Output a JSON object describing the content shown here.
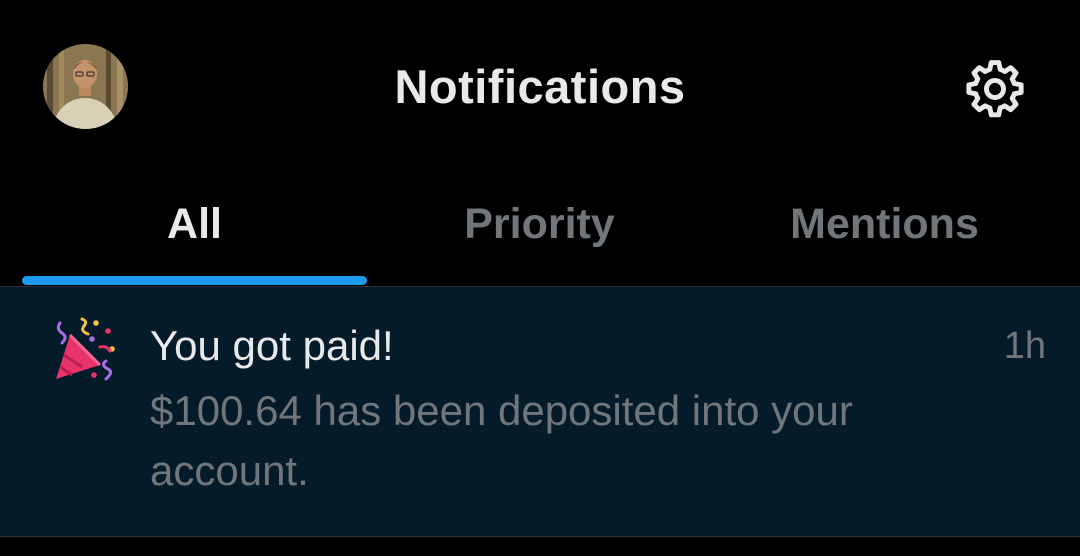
{
  "header": {
    "title": "Notifications",
    "avatar_icon": "user-avatar",
    "settings_icon": "gear-icon"
  },
  "tabs": [
    {
      "label": "All",
      "active": true
    },
    {
      "label": "Priority",
      "active": false
    },
    {
      "label": "Mentions",
      "active": false
    }
  ],
  "notifications": [
    {
      "icon": "party-popper-icon",
      "title": "You got paid!",
      "time": "1h",
      "body": "$100.64 has been deposited into your account."
    }
  ],
  "colors": {
    "accent": "#1d9bf0",
    "background": "#000000",
    "unread_background": "#061b29",
    "primary_text": "#e7e9ea",
    "secondary_text": "#71767b"
  }
}
